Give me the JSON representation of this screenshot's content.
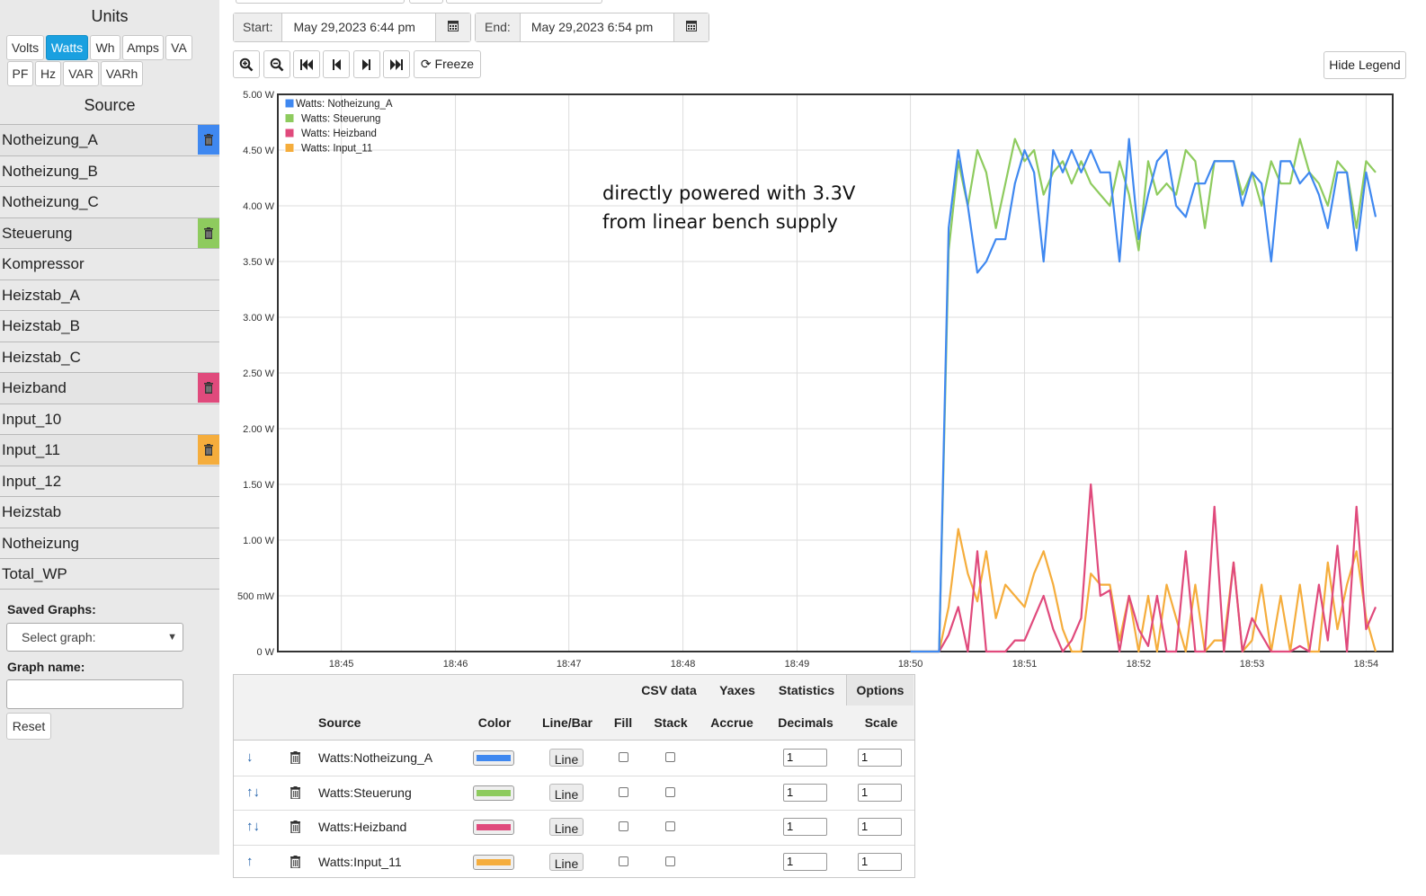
{
  "sidebar": {
    "units_title": "Units",
    "units": [
      {
        "label": "Volts",
        "active": false
      },
      {
        "label": "Watts",
        "active": true
      },
      {
        "label": "Wh",
        "active": false
      },
      {
        "label": "Amps",
        "active": false
      },
      {
        "label": "VA",
        "active": false
      },
      {
        "label": "PF",
        "active": false
      },
      {
        "label": "Hz",
        "active": false
      },
      {
        "label": "VAR",
        "active": false
      },
      {
        "label": "VARh",
        "active": false
      }
    ],
    "source_title": "Source",
    "sources": [
      {
        "label": "Notheizung_A",
        "selected": true,
        "color": "#3f88f0"
      },
      {
        "label": "Notheizung_B",
        "selected": false
      },
      {
        "label": "Notheizung_C",
        "selected": false
      },
      {
        "label": "Steuerung",
        "selected": true,
        "color": "#8ecb5e"
      },
      {
        "label": "Kompressor",
        "selected": false
      },
      {
        "label": "Heizstab_A",
        "selected": false
      },
      {
        "label": "Heizstab_B",
        "selected": false
      },
      {
        "label": "Heizstab_C",
        "selected": false
      },
      {
        "label": "Heizband",
        "selected": true,
        "color": "#e04a7c"
      },
      {
        "label": "Input_10",
        "selected": false
      },
      {
        "label": "Input_11",
        "selected": true,
        "color": "#f5ad3c"
      },
      {
        "label": "Input_12",
        "selected": false
      },
      {
        "label": "Heizstab",
        "selected": false
      },
      {
        "label": "Notheizung",
        "selected": false
      },
      {
        "label": "Total_WP",
        "selected": false
      }
    ],
    "saved_graphs_label": "Saved Graphs:",
    "saved_graphs_select": "Select graph:",
    "graph_name_label": "Graph name:",
    "graph_name_value": "",
    "reset_label": "Reset"
  },
  "toolbar": {
    "start_label": "Start:",
    "start_value": "May 29,2023 6:44 pm",
    "end_label": "End:",
    "end_value": "May 29,2023 6:54 pm",
    "freeze_label": "Freeze",
    "hide_legend_label": "Hide Legend"
  },
  "annotation": {
    "line1": "directly powered with 3.3V",
    "line2": "from linear bench supply"
  },
  "chart_data": {
    "type": "line",
    "ylabel": "",
    "xlabel": "",
    "y_tick_labels": [
      "0 W",
      "500 mW",
      "1.00 W",
      "1.50 W",
      "2.00 W",
      "2.50 W",
      "3.00 W",
      "3.50 W",
      "4.00 W",
      "4.50 W",
      "5.00 W"
    ],
    "ylim": [
      0,
      5
    ],
    "x_tick_labels": [
      "18:45",
      "18:46",
      "18:47",
      "18:48",
      "18:49",
      "18:50",
      "18:51",
      "18:52",
      "18:53",
      "18:54"
    ],
    "x_ticks": [
      18.75,
      18.7667,
      18.7833,
      18.8,
      18.8167,
      18.8333,
      18.85,
      18.8667,
      18.8833,
      18.9
    ],
    "xlim": [
      18.7407,
      18.9039
    ],
    "grid": true,
    "legend_position": "top-left",
    "x": [
      18.8333,
      18.8361,
      18.8375,
      18.8389,
      18.8403,
      18.8417,
      18.8431,
      18.8444,
      18.8458,
      18.8472,
      18.8486,
      18.85,
      18.8514,
      18.8528,
      18.8542,
      18.8556,
      18.8569,
      18.8583,
      18.8597,
      18.8611,
      18.8625,
      18.8639,
      18.8653,
      18.8667,
      18.8681,
      18.8694,
      18.8708,
      18.8722,
      18.8736,
      18.875,
      18.8764,
      18.8778,
      18.8792,
      18.8806,
      18.8819,
      18.8833,
      18.8847,
      18.8861,
      18.8875,
      18.8889,
      18.8903,
      18.8917,
      18.8931,
      18.8944,
      18.8958,
      18.8972,
      18.8986,
      18.9,
      18.9014
    ],
    "series": [
      {
        "name": "Watts: Notheizung_A",
        "color": "#3f88f0",
        "values": [
          0,
          0,
          0,
          3.8,
          4.5,
          4.0,
          3.4,
          3.5,
          3.7,
          3.7,
          4.2,
          4.5,
          4.3,
          3.5,
          4.5,
          4.3,
          4.5,
          4.3,
          4.5,
          4.3,
          4.3,
          3.5,
          4.6,
          3.7,
          4.1,
          4.4,
          4.5,
          4.0,
          3.9,
          4.2,
          4.2,
          4.4,
          4.4,
          4.4,
          4.0,
          4.3,
          4.2,
          3.5,
          4.4,
          4.4,
          4.2,
          4.3,
          4.1,
          3.8,
          4.3,
          4.3,
          3.6,
          4.3,
          3.9
        ]
      },
      {
        "name": "Watts: Steuerung",
        "color": "#8ecb5e",
        "values": [
          0,
          0,
          0,
          3.6,
          4.4,
          4.0,
          4.5,
          4.3,
          3.8,
          4.2,
          4.6,
          4.4,
          4.5,
          4.1,
          4.3,
          4.4,
          4.2,
          4.4,
          4.2,
          4.1,
          4.0,
          4.4,
          4.1,
          3.6,
          4.4,
          4.1,
          4.2,
          4.1,
          4.5,
          4.4,
          3.8,
          4.4,
          4.4,
          4.4,
          4.1,
          4.3,
          4.0,
          4.4,
          4.2,
          4.2,
          4.6,
          4.3,
          4.2,
          4.0,
          4.4,
          4.3,
          3.8,
          4.4,
          4.3
        ]
      },
      {
        "name": "Watts: Heizband",
        "color": "#e04a7c",
        "values": [
          0,
          0,
          0,
          0.15,
          0.4,
          0,
          0.9,
          0,
          0,
          0,
          0.1,
          0.1,
          0.3,
          0.5,
          0.2,
          0,
          0.1,
          0.3,
          1.5,
          0.5,
          0.55,
          0,
          0.5,
          0.2,
          0.05,
          0.5,
          0,
          0,
          0.9,
          0,
          0,
          1.3,
          0,
          0.8,
          0,
          0.3,
          0.15,
          0,
          0,
          0,
          0.05,
          0,
          0.6,
          0.1,
          0.95,
          0,
          1.3,
          0.2,
          0.4
        ]
      },
      {
        "name": "Watts: Input_11",
        "color": "#f5ad3c",
        "values": [
          0,
          0,
          0,
          0.4,
          1.1,
          0.7,
          0.45,
          0.9,
          0.3,
          0.6,
          0.5,
          0.4,
          0.7,
          0.9,
          0.6,
          0.2,
          0,
          0,
          0.7,
          0.6,
          0.6,
          0.1,
          0.5,
          0,
          0.5,
          0,
          0.6,
          0.3,
          0,
          0.6,
          0,
          0.1,
          0.1,
          0.8,
          0,
          0.1,
          0.6,
          0,
          0.5,
          0,
          0.6,
          0,
          0,
          0.8,
          0.2,
          0.6,
          0.9,
          0.3,
          0
        ]
      }
    ]
  },
  "options_panel": {
    "tabs": [
      {
        "label": "CSV data",
        "active": false
      },
      {
        "label": "Yaxes",
        "active": false
      },
      {
        "label": "Statistics",
        "active": false
      },
      {
        "label": "Options",
        "active": true
      }
    ],
    "headers": {
      "source": "Source",
      "color": "Color",
      "linebar": "Line/Bar",
      "fill": "Fill",
      "stack": "Stack",
      "accrue": "Accrue",
      "decimals": "Decimals",
      "scale": "Scale"
    },
    "rows": [
      {
        "arrows": "↓",
        "source": "Watts:Notheizung_A",
        "color": "#3f88f0",
        "linebar": "Line",
        "decimals": "1",
        "scale": "1"
      },
      {
        "arrows": "↑↓",
        "source": "Watts:Steuerung",
        "color": "#8ecb5e",
        "linebar": "Line",
        "decimals": "1",
        "scale": "1"
      },
      {
        "arrows": "↑↓",
        "source": "Watts:Heizband",
        "color": "#e04a7c",
        "linebar": "Line",
        "decimals": "1",
        "scale": "1"
      },
      {
        "arrows": "↑",
        "source": "Watts:Input_11",
        "color": "#f5ad3c",
        "linebar": "Line",
        "decimals": "1",
        "scale": "1"
      }
    ]
  }
}
